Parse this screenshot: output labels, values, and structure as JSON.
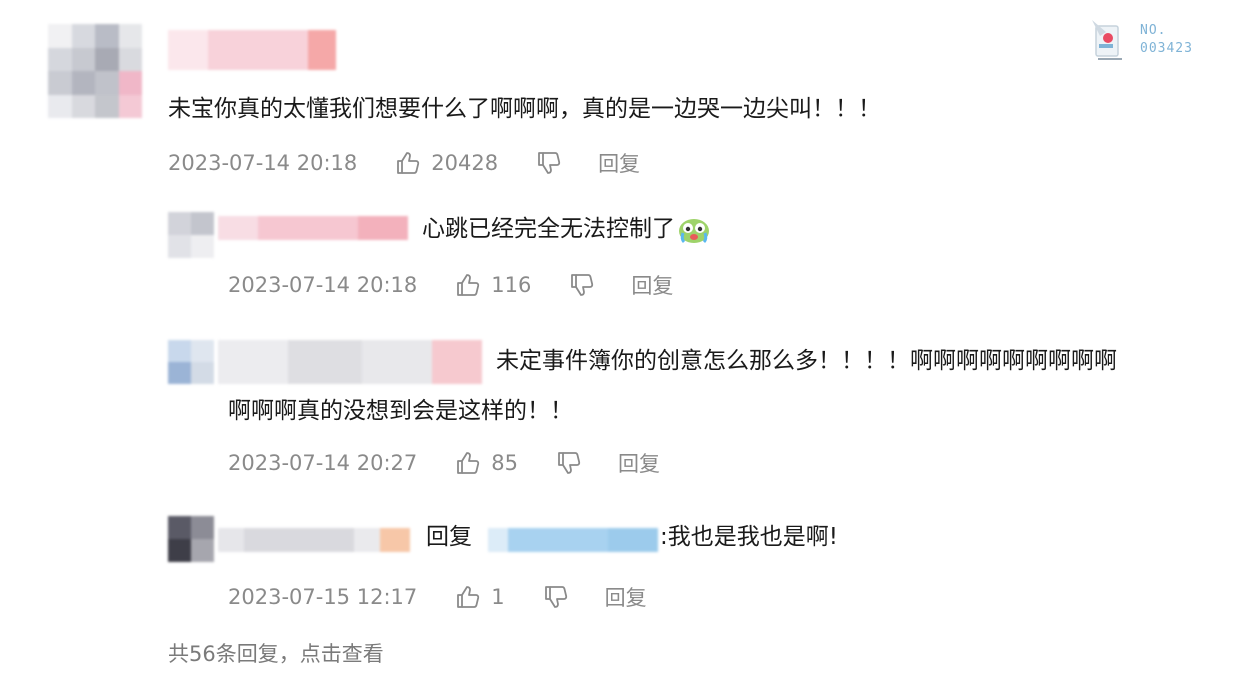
{
  "watermark": {
    "line1": "NO.",
    "line2": "003423"
  },
  "comment": {
    "text": "未宝你真的太懂我们想要什么了啊啊啊，真的是一边哭一边尖叫！！！",
    "time": "2023-07-14 20:18",
    "likes": "20428",
    "reply_label": "回复"
  },
  "replies": [
    {
      "text": "心跳已经完全无法控制了",
      "time": "2023-07-14 20:18",
      "likes": "116",
      "reply_label": "回复"
    },
    {
      "text_line1": "未定事件簿你的创意怎么那么多！！！！啊啊啊啊啊啊啊啊啊",
      "text_line2": "啊啊啊真的没想到会是这样的！！",
      "time": "2023-07-14 20:27",
      "likes": "85",
      "reply_label": "回复"
    },
    {
      "prefix": "回复",
      "text": ":我也是我也是啊!",
      "time": "2023-07-15 12:17",
      "likes": "1",
      "reply_label": "回复"
    }
  ],
  "more_replies": "共56条回复，点击查看",
  "icons": {
    "like": "thumbs-up-icon",
    "dislike": "thumbs-down-icon",
    "emoji": "crying-face-emoji"
  },
  "colors": {
    "meta_text": "#8a8a8a",
    "username_blur": "#f4a6b4",
    "mention_blur": "#9ccbec"
  }
}
